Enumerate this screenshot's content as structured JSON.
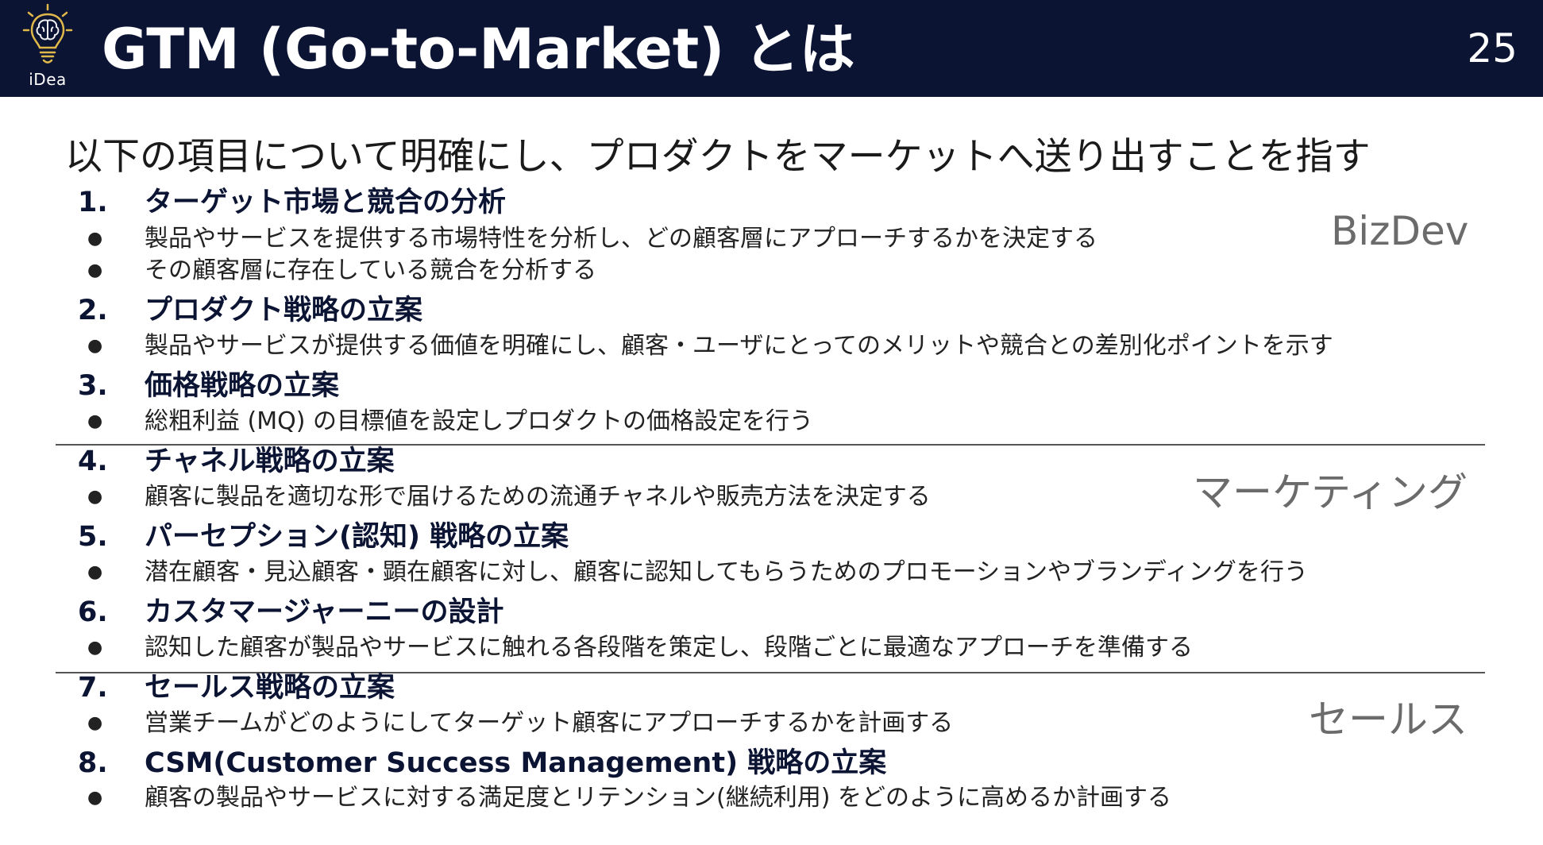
{
  "header": {
    "logo_text": "iDea",
    "title": "GTM (Go-to-Market) とは",
    "page_number": "25"
  },
  "subtitle": "以下の項目について明確にし、プロダクトをマーケットへ送り出すことを指す",
  "items": [
    {
      "num": "1.",
      "title": "ターゲット市場と競合の分析",
      "bullets": [
        "製品やサービスを提供する市場特性を分析し、どの顧客層にアプローチするかを決定する",
        "その顧客層に存在している競合を分析する"
      ]
    },
    {
      "num": "2.",
      "title": "プロダクト戦略の立案",
      "bullets": [
        "製品やサービスが提供する価値を明確にし、顧客・ユーザにとってのメリットや競合との差別化ポイントを示す"
      ]
    },
    {
      "num": "3.",
      "title": "価格戦略の立案",
      "bullets": [
        "総粗利益 (MQ) の目標値を設定しプロダクトの価格設定を行う"
      ]
    },
    {
      "num": "4.",
      "title": "チャネル戦略の立案",
      "bullets": [
        "顧客に製品を適切な形で届けるための流通チャネルや販売方法を決定する"
      ]
    },
    {
      "num": "5.",
      "title": "パーセプション(認知) 戦略の立案",
      "bullets": [
        "潜在顧客・見込顧客・顕在顧客に対し、顧客に認知してもらうためのプロモーションやブランディングを行う"
      ]
    },
    {
      "num": "6.",
      "title": "カスタマージャーニーの設計",
      "bullets": [
        "認知した顧客が製品やサービスに触れる各段階を策定し、段階ごとに最適なアプローチを準備する"
      ]
    },
    {
      "num": "7.",
      "title": "セールス戦略の立案",
      "bullets": [
        "営業チームがどのようにしてターゲット顧客にアプローチするかを計画する"
      ]
    },
    {
      "num": "8.",
      "title": "CSM(Customer Success Management) 戦略の立案",
      "bullets": [
        "顧客の製品やサービスに対する満足度とリテンション(継続利用) をどのように高めるか計画する"
      ]
    }
  ],
  "categories": {
    "bizdev": "BizDev",
    "marketing": "マーケティング",
    "sales": "セールス"
  },
  "bullet_char": "●",
  "colors": {
    "header_bg": "#0c1434",
    "category_text": "#6b6b6b",
    "divider": "#555555"
  }
}
